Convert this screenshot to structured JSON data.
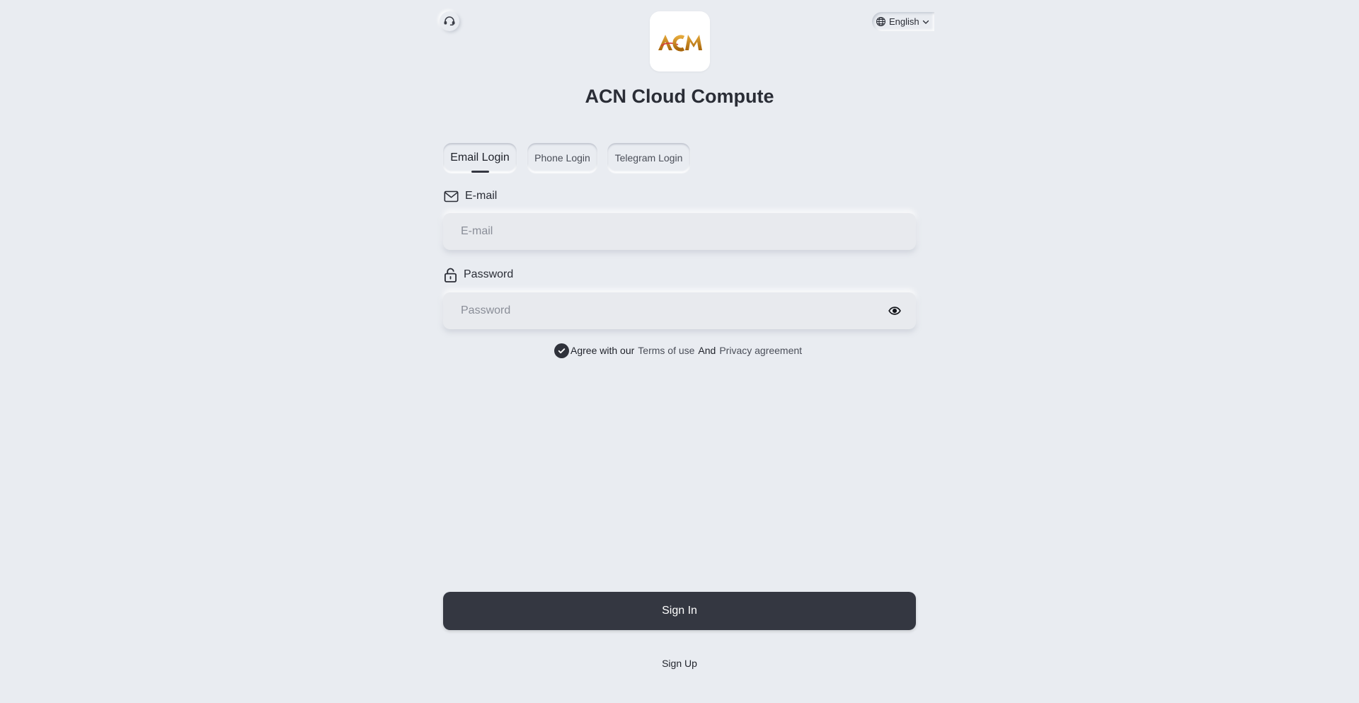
{
  "header": {
    "support_icon": "headset-icon",
    "language": {
      "label": "English",
      "icon": "globe-icon",
      "chevron": "chevron-down-icon"
    },
    "logo_text": "ACM",
    "title": "ACN Cloud Compute"
  },
  "tabs": [
    {
      "label": "Email Login",
      "active": true
    },
    {
      "label": "Phone Login",
      "active": false
    },
    {
      "label": "Telegram Login",
      "active": false
    }
  ],
  "form": {
    "email": {
      "label": "E-mail",
      "placeholder": "E-mail",
      "value": "",
      "icon": "mail-icon"
    },
    "password": {
      "label": "Password",
      "placeholder": "Password",
      "value": "",
      "icon": "unlock-icon",
      "toggle_icon": "eye-icon"
    }
  },
  "agreement": {
    "checked": true,
    "prefix": "Agree with our",
    "terms": "Terms of use",
    "and": "And",
    "privacy": "Privacy agreement"
  },
  "actions": {
    "sign_in": "Sign In",
    "sign_up": "Sign Up"
  },
  "colors": {
    "background": "#e9ecf1",
    "primary_button": "#343741",
    "logo_gold": "#c98a1a"
  }
}
